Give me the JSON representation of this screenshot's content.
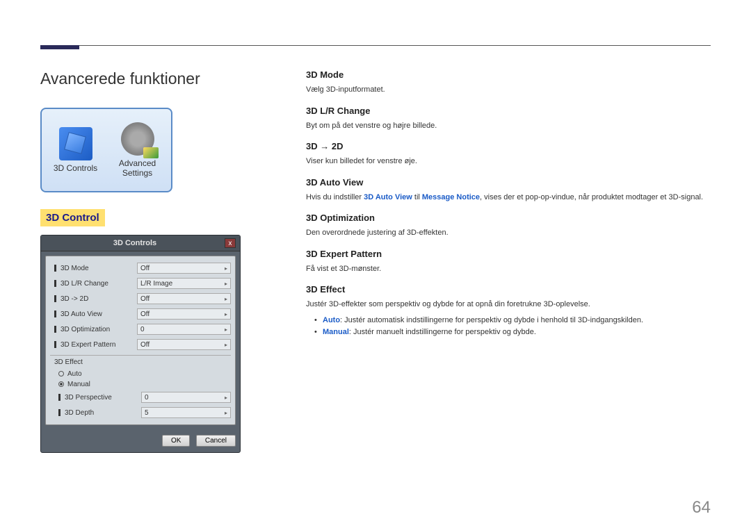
{
  "page_title": "Avancerede funktioner",
  "page_number": "64",
  "thumbnail": {
    "item1_label": "3D Controls",
    "item2_label_l1": "Advanced",
    "item2_label_l2": "Settings"
  },
  "section_heading": "3D Control",
  "controls_panel": {
    "title": "3D Controls",
    "close": "x",
    "rows": [
      {
        "label": "3D Mode",
        "value": "Off"
      },
      {
        "label": "3D L/R Change",
        "value": "L/R Image"
      },
      {
        "label": "3D -> 2D",
        "value": "Off"
      },
      {
        "label": "3D Auto View",
        "value": "Off"
      },
      {
        "label": "3D Optimization",
        "value": "0"
      },
      {
        "label": "3D Expert Pattern",
        "value": "Off"
      }
    ],
    "effect_label": "3D Effect",
    "radio_auto": "Auto",
    "radio_manual": "Manual",
    "sub_rows": [
      {
        "label": "3D Perspective",
        "value": "0"
      },
      {
        "label": "3D Depth",
        "value": "5"
      }
    ],
    "ok": "OK",
    "cancel": "Cancel"
  },
  "right": {
    "s1_h": "3D Mode",
    "s1_b": "Vælg 3D-inputformatet.",
    "s2_h": "3D L/R Change",
    "s2_b": "Byt om på det venstre og højre billede.",
    "s3_h": "3D → 2D",
    "s3_b": "Viser kun billedet for venstre øje.",
    "s4_h": "3D Auto View",
    "s4_pre": "Hvis du indstiller ",
    "s4_kw1": "3D Auto View",
    "s4_mid": " til ",
    "s4_kw2": "Message Notice",
    "s4_post": ", vises der et pop-op-vindue, når produktet modtager et 3D-signal.",
    "s5_h": "3D Optimization",
    "s5_b": "Den overordnede justering af 3D-effekten.",
    "s6_h": "3D Expert Pattern",
    "s6_b": "Få vist et 3D-mønster.",
    "s7_h": "3D Effect",
    "s7_b": "Justér 3D-effekter som perspektiv og dybde for at opnå din foretrukne 3D-oplevelse.",
    "s7_li1_kw": "Auto",
    "s7_li1_rest": ": Justér automatisk indstillingerne for perspektiv og dybde i henhold til 3D-indgangskilden.",
    "s7_li2_kw": "Manual",
    "s7_li2_rest": ": Justér manuelt indstillingerne for perspektiv og dybde."
  }
}
